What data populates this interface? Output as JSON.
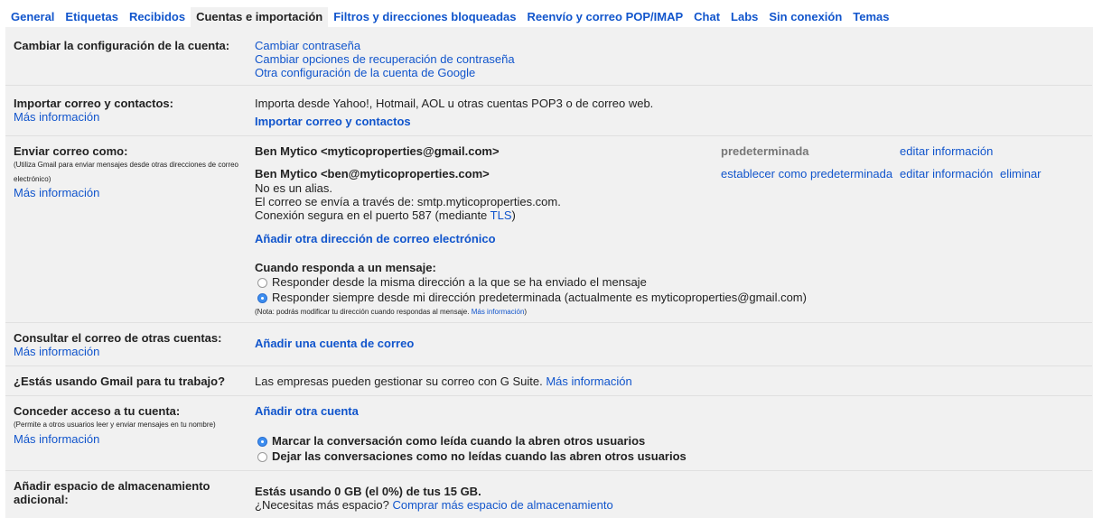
{
  "tabs": [
    "General",
    "Etiquetas",
    "Recibidos",
    "Cuentas e importación",
    "Filtros y direcciones bloqueadas",
    "Reenvío y correo POP/IMAP",
    "Chat",
    "Labs",
    "Sin conexión",
    "Temas"
  ],
  "change_account": {
    "label": "Cambiar la configuración de la cuenta:",
    "links": [
      "Cambiar contraseña",
      "Cambiar opciones de recuperación de contraseña",
      "Otra configuración de la cuenta de Google"
    ]
  },
  "import": {
    "label": "Importar correo y contactos:",
    "more": "Más información",
    "text": "Importa desde Yahoo!, Hotmail, AOL u otras cuentas POP3 o de correo web.",
    "action": "Importar correo y contactos"
  },
  "send_as": {
    "label": "Enviar correo como:",
    "note": "(Utiliza Gmail para enviar mensajes desde otras direcciones de correo electrónico)",
    "more": "Más información",
    "address1": "Ben Mytico <myticoproperties@gmail.com>",
    "default_badge": "predeterminada",
    "edit1": "editar información",
    "address2": "Ben Mytico <ben@myticoproperties.com>",
    "set_default": "establecer como predeterminada",
    "edit2": "editar información",
    "delete": "eliminar",
    "alias_note": "No es un alias.",
    "smtp_note": "El correo se envía a través de: smtp.myticoproperties.com.",
    "secure_prefix": "Conexión segura en el puerto 587 (mediante ",
    "tls": "TLS",
    "secure_suffix": ")",
    "add_address": "Añadir otra dirección de correo electrónico",
    "reply_heading": "Cuando responda a un mensaje:",
    "reply_option1": "Responder desde la misma dirección a la que se ha enviado el mensaje",
    "reply_option2": "Responder siempre desde mi dirección predeterminada (actualmente es myticoproperties@gmail.com)",
    "reply_selected": 2,
    "reply_note": "(Nota: podrás modificar tu dirección cuando respondas al mensaje.",
    "reply_note_link": "Más información",
    "reply_note_end": ")"
  },
  "check_mail": {
    "label": "Consultar el correo de otras cuentas:",
    "more": "Más información",
    "action": "Añadir una cuenta de correo"
  },
  "work": {
    "label": "¿Estás usando Gmail para tu trabajo?",
    "text": "Las empresas pueden gestionar su correo con G Suite.",
    "link": "Más información"
  },
  "grant": {
    "label": "Conceder acceso a tu cuenta:",
    "note": "(Permite a otros usuarios leer y enviar mensajes en tu nombre)",
    "more": "Más información",
    "action": "Añadir otra cuenta",
    "option1": "Marcar la conversación como leída cuando la abren otros usuarios",
    "option2": "Dejar las conversaciones como no leídas cuando las abren otros usuarios",
    "selected": 1
  },
  "storage": {
    "label": "Añadir espacio de almacenamiento adicional:",
    "usage": "Estás usando 0 GB (el 0%) de tus 15 GB.",
    "question": "¿Necesitas más espacio?",
    "link": "Comprar más espacio de almacenamiento"
  }
}
